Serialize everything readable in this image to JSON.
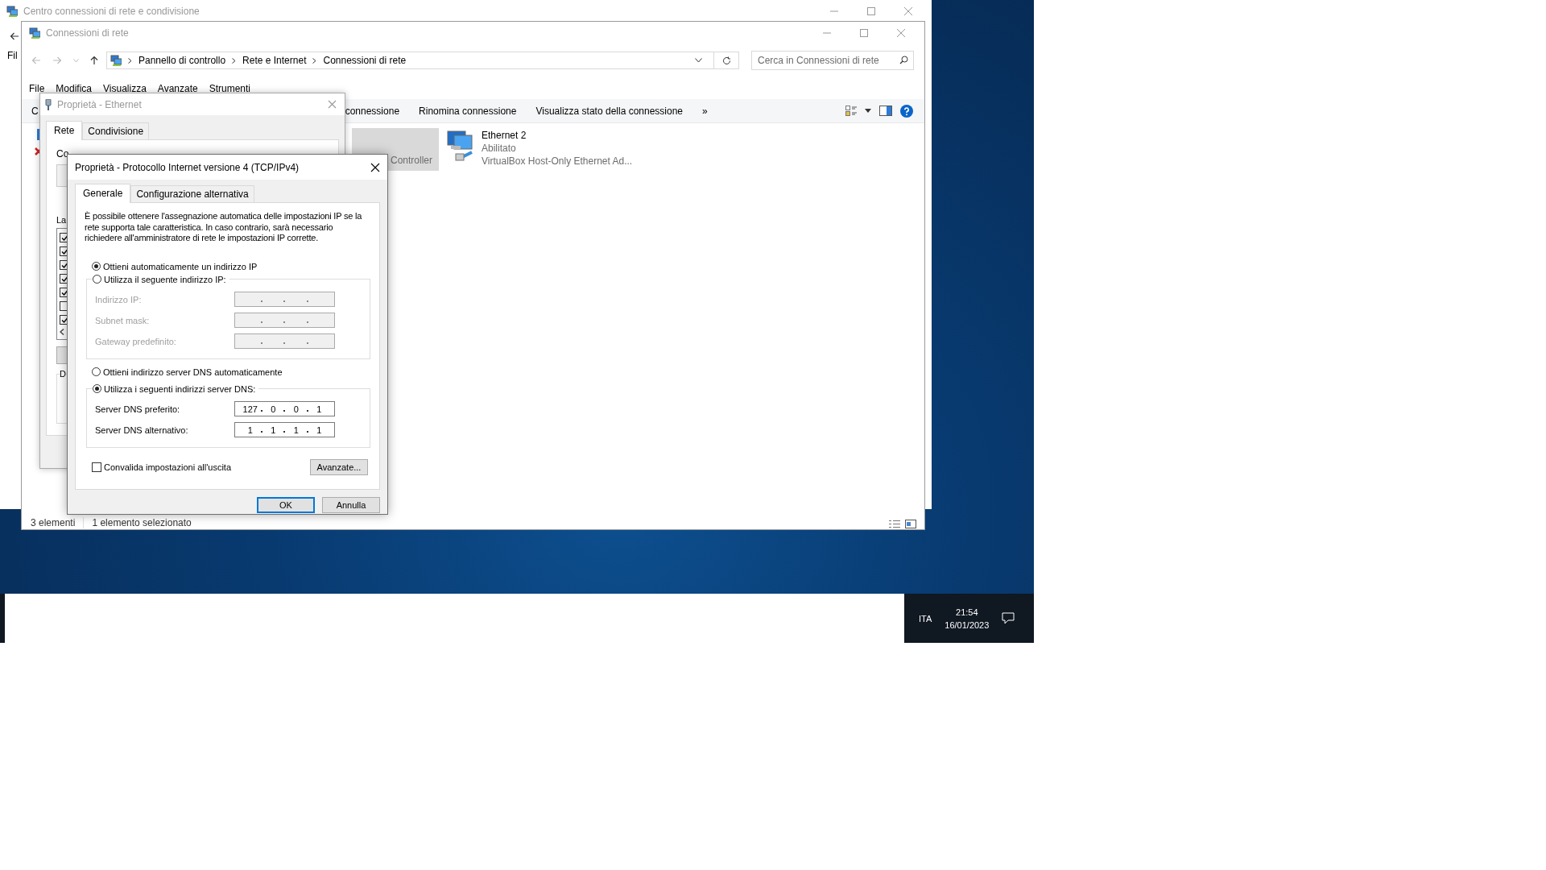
{
  "back_window": {
    "title": "Centro connessioni di rete e condivisione",
    "menu_fragment": "Fil"
  },
  "main_window": {
    "title": "Connessioni di rete",
    "address": [
      "Pannello di controllo",
      "Rete e Internet",
      "Connessioni di rete"
    ],
    "search": {
      "placeholder": "Cerca in Connessioni di rete"
    },
    "menu": [
      "File",
      "Modifica",
      "Visualizza",
      "Avanzate",
      "Strumenti"
    ],
    "commands": [
      "C",
      "connessione",
      "Rinomina connessione",
      "Visualizza stato della connessione"
    ],
    "more": "»",
    "connections": [
      {
        "kind": "edge",
        "selected": false
      },
      {
        "kind": "tile",
        "text": "Controller",
        "selected": true
      },
      {
        "kind": "full",
        "name": "Ethernet 2",
        "status": "Abilitato",
        "device": "VirtualBox Host-Only Ethernet Ad...",
        "selected": false
      }
    ],
    "status_bar": {
      "count": "3 elementi",
      "selection": "1 elemento selezionato"
    }
  },
  "ethernet_dialog": {
    "title": "Proprietà - Ethernet",
    "tabs": [
      {
        "label": "Rete",
        "selected": true
      },
      {
        "label": "Condivisione",
        "selected": false
      }
    ],
    "connect_label": "Co",
    "list_label": "La",
    "group_label": "D",
    "components": [
      {
        "checked": true
      },
      {
        "checked": true
      },
      {
        "checked": true
      },
      {
        "checked": true
      },
      {
        "checked": true
      },
      {
        "checked": false
      },
      {
        "checked": true
      }
    ]
  },
  "ipv4_dialog": {
    "title": "Proprietà - Protocollo Internet versione 4 (TCP/IPv4)",
    "tabs": [
      {
        "label": "Generale",
        "selected": true
      },
      {
        "label": "Configurazione alternativa",
        "selected": false
      }
    ],
    "intro": "È possibile ottenere l'assegnazione automatica delle impostazioni IP se la rete supporta tale caratteristica. In caso contrario, sarà necessario richiedere all'amministratore di rete le impostazioni IP corrette.",
    "ip_mode": [
      {
        "label": "Ottieni automaticamente un indirizzo IP",
        "selected": true
      },
      {
        "label": "Utilizza il seguente indirizzo IP:",
        "selected": false
      }
    ],
    "ip_fields": [
      {
        "label": "Indirizzo IP:",
        "disabled": true
      },
      {
        "label": "Subnet mask:",
        "disabled": true
      },
      {
        "label": "Gateway predefinito:",
        "disabled": true
      }
    ],
    "dns_mode": [
      {
        "label": "Ottieni indirizzo server DNS automaticamente",
        "selected": false
      },
      {
        "label": "Utilizza i seguenti indirizzi server DNS:",
        "selected": true
      }
    ],
    "dns_fields": [
      {
        "label": "Server DNS preferito:",
        "disabled": false,
        "octets": [
          "127",
          "0",
          "0",
          "1"
        ]
      },
      {
        "label": "Server DNS alternativo:",
        "disabled": false,
        "octets": [
          "1",
          "1",
          "1",
          "1"
        ]
      }
    ],
    "validate": {
      "label": "Convalida impostazioni all'uscita",
      "checked": false
    },
    "advanced_button": "Avanzate...",
    "buttons": [
      {
        "label": "OK",
        "default": true
      },
      {
        "label": "Annulla",
        "default": false
      }
    ]
  },
  "taskbar": {
    "language": "ITA",
    "time": "21:54",
    "date": "16/01/2023"
  }
}
